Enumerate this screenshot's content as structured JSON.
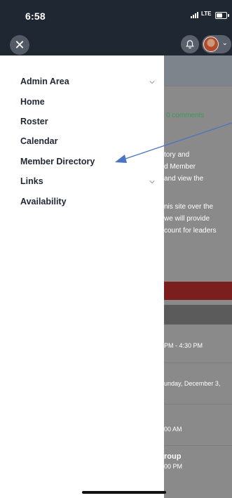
{
  "status_bar": {
    "time": "6:58",
    "network": "LTE",
    "battery_percent": 65
  },
  "header": {
    "close_icon": "close-icon",
    "bell_icon": "bell-icon",
    "chevron_icon": "chevron-down-icon"
  },
  "drawer": {
    "items": [
      {
        "label": "Admin Area",
        "expandable": true
      },
      {
        "label": "Home",
        "expandable": false
      },
      {
        "label": "Roster",
        "expandable": false
      },
      {
        "label": "Calendar",
        "expandable": false
      },
      {
        "label": "Member Directory",
        "expandable": false
      },
      {
        "label": "Links",
        "expandable": true
      },
      {
        "label": "Availability",
        "expandable": false
      }
    ]
  },
  "background": {
    "comments": "0 comments",
    "text_lines": [
      "tory and",
      "d Member",
      "and view the",
      "nis site over the",
      "we will provide",
      "count for leaders"
    ],
    "event_1_time": "PM - 4:30 PM",
    "event_2_date": "unday, December 3,",
    "event_3_time": "00 AM",
    "event_4_title": "roup",
    "event_4_time": "00 PM"
  },
  "colors": {
    "header_bg": "#1f2733",
    "arrow": "#4a74c4",
    "red_bar": "#7a1e1e",
    "green_text": "#3a9a55"
  }
}
